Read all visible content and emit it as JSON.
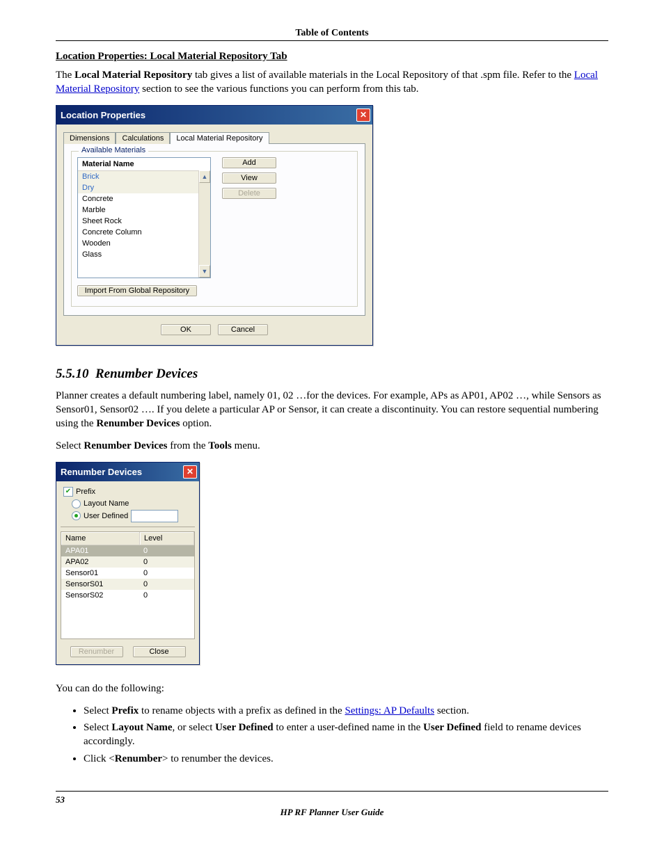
{
  "toc_header": "Table of Contents",
  "section1": {
    "heading": "Location Properties: Local Material Repository Tab",
    "text_pre": "The ",
    "text_bold": "Local Material Repository",
    "text_mid": " tab gives a list of available materials in the Local Repository of that .spm file. Refer to the ",
    "link": "Local Material Repository",
    "text_post": " section to see the various functions you can perform from this tab."
  },
  "dlg1": {
    "title": "Location Properties",
    "tabs": [
      "Dimensions",
      "Calculations",
      "Local Material Repository"
    ],
    "fieldset_legend": "Available Materials",
    "list_header": "Material Name",
    "materials": [
      "Brick",
      "Dry",
      "Concrete",
      "Marble",
      "Sheet Rock",
      "Concrete Column",
      "Wooden",
      "Glass"
    ],
    "btn_add": "Add",
    "btn_view": "View",
    "btn_delete": "Delete",
    "btn_import": "Import From Global Repository",
    "btn_ok": "OK",
    "btn_cancel": "Cancel"
  },
  "section2": {
    "number": "5.5.10",
    "title": "Renumber Devices",
    "para1_a": "Planner creates a default numbering label, namely 01, 02 …for the devices. For example, APs as AP01, AP02 …, while Sensors as Sensor01, Sensor02 …. If you delete a particular AP or Sensor, it can create a discontinuity. You can restore sequential numbering using the ",
    "para1_bold": "Renumber Devices",
    "para1_b": " option.",
    "para2_a": "Select ",
    "para2_bold1": "Renumber Devices",
    "para2_b": " from the ",
    "para2_bold2": "Tools",
    "para2_c": " menu."
  },
  "dlg2": {
    "title": "Renumber Devices",
    "chk_prefix": "Prefix",
    "radio_layout": "Layout Name",
    "radio_user": "User Defined",
    "col_name": "Name",
    "col_level": "Level",
    "rows": [
      {
        "name": "APA01",
        "level": "0"
      },
      {
        "name": "APA02",
        "level": "0"
      },
      {
        "name": "Sensor01",
        "level": "0"
      },
      {
        "name": "SensorS01",
        "level": "0"
      },
      {
        "name": "SensorS02",
        "level": "0"
      }
    ],
    "btn_renumber": "Renumber",
    "btn_close": "Close"
  },
  "instructions": {
    "lead": "You can do the following:",
    "b1_a": "Select ",
    "b1_bold": "Prefix",
    "b1_b": " to rename objects with a prefix as defined in the ",
    "b1_link": "Settings: AP Defaults",
    "b1_c": " section.",
    "b2_a": "Select ",
    "b2_bold1": "Layout Name",
    "b2_b": ", or select ",
    "b2_bold2": "User Defined",
    "b2_c": " to enter a user-defined name in the ",
    "b2_bold3": "User Defined",
    "b2_d": " field to rename devices accordingly.",
    "b3_a": "Click <",
    "b3_bold": "Renumber",
    "b3_b": "> to renumber the devices."
  },
  "footer": {
    "page": "53",
    "title": "HP RF Planner User Guide"
  }
}
